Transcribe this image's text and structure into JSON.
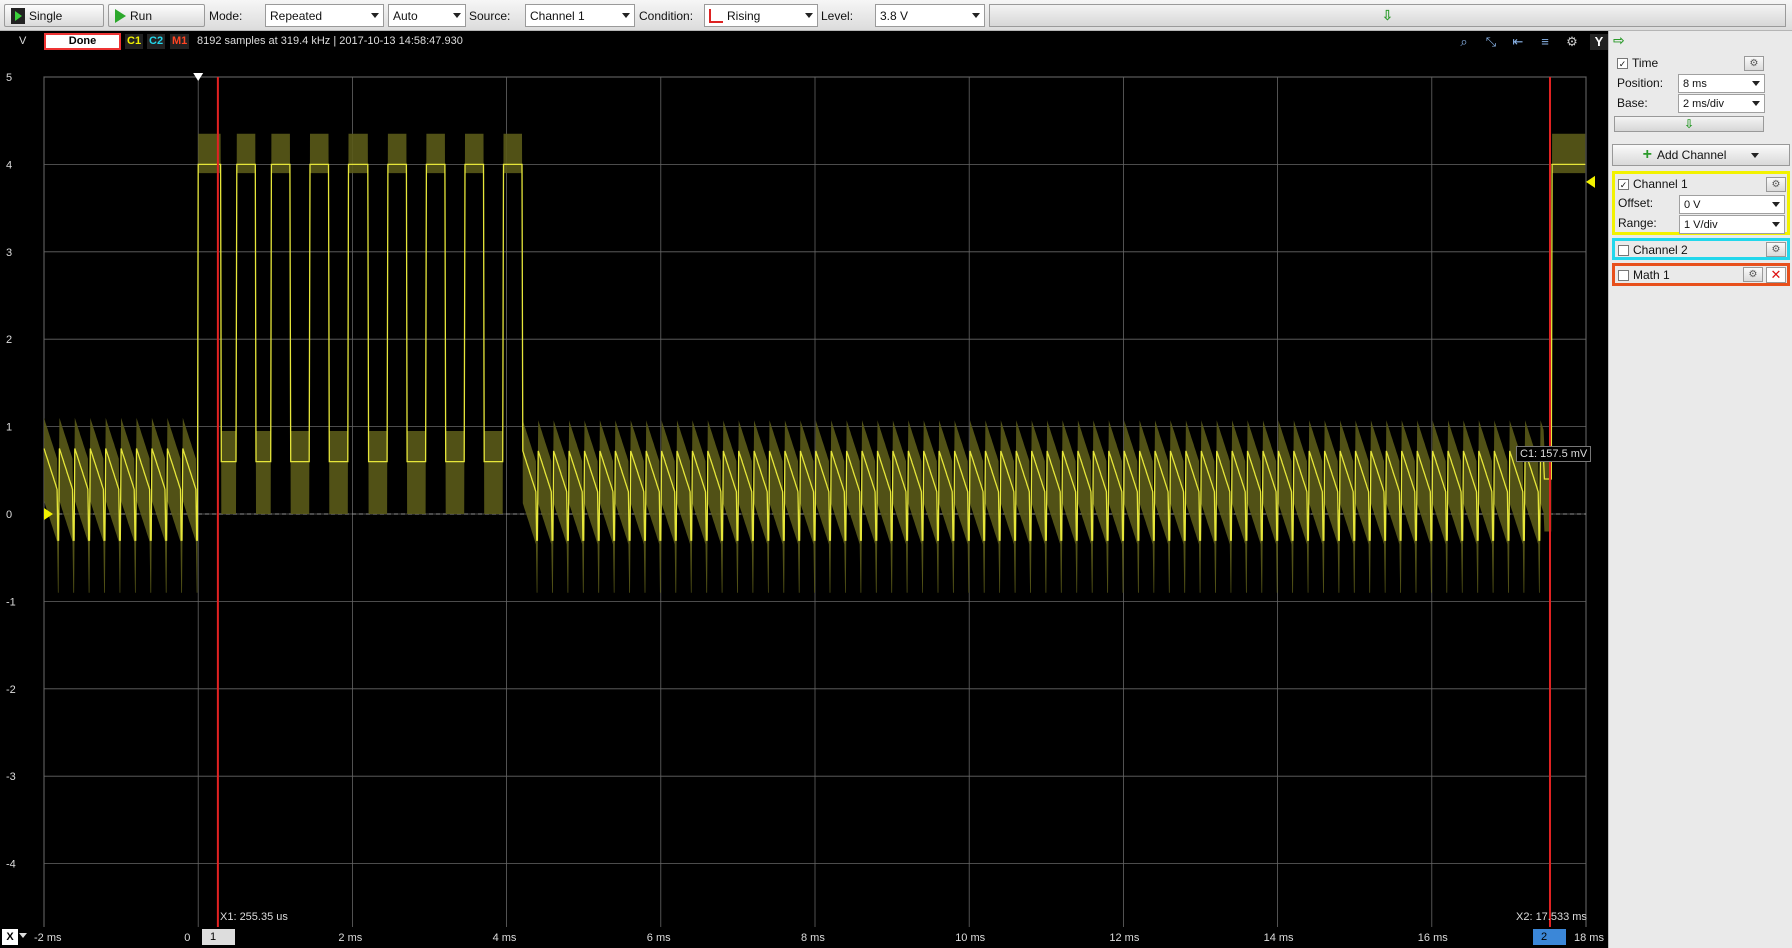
{
  "toolbar": {
    "single_label": "Single",
    "run_label": "Run",
    "mode_label": "Mode:",
    "mode_value": "Repeated",
    "auto_value": "Auto",
    "source_label": "Source:",
    "source_value": "Channel 1",
    "condition_label": "Condition:",
    "condition_value": "Rising",
    "level_label": "Level:",
    "level_value": "3.8 V",
    "slider_glyph": "⇩"
  },
  "scope": {
    "unit_label": "V",
    "status": "Done",
    "tags": [
      "C1",
      "C2",
      "M1"
    ],
    "info": "8192 samples at 319.4 kHz | 2017-10-13 14:58:47.930",
    "y_axis_title": "Y",
    "y_ticks": [
      "5",
      "4",
      "3",
      "2",
      "1",
      "0",
      "-1",
      "-2",
      "-3",
      "-4",
      "-5"
    ],
    "x_ticks": [
      "-2 ms",
      "0",
      "2 ms",
      "4 ms",
      "6 ms",
      "8 ms",
      "10 ms",
      "12 ms",
      "14 ms",
      "16 ms",
      "18 ms"
    ],
    "x_axis_title": "X",
    "cursor1_label": "X1: 255.35 us",
    "cursor2_label": "X2: 17.533 ms",
    "cursor1_index": "1",
    "cursor2_index": "2",
    "measurement": "C1: 157.5 mV",
    "colors": {
      "trace": "#e6e63a",
      "envelope": "#5a5a18",
      "cursor": "#e22222",
      "grid": "#777777"
    }
  },
  "chart_data": {
    "type": "line",
    "xlabel": "",
    "ylabel": "V",
    "xlim": [
      -2,
      18
    ],
    "ylim": [
      -5,
      5
    ],
    "grid": true,
    "series": [
      {
        "name": "C1",
        "x": [
          -2,
          -1.8,
          -1.6,
          -1.4,
          -1.2,
          -1.0,
          -0.2,
          0,
          0.05,
          0.3,
          0.5,
          0.75,
          0.95,
          1.2,
          1.45,
          1.7,
          1.95,
          2.2,
          2.45,
          2.7,
          2.95,
          3.2,
          3.45,
          3.7,
          3.95,
          4.2,
          5,
          8,
          12,
          16,
          17.4,
          17.55,
          18
        ],
        "y": [
          0.6,
          0.3,
          0.7,
          0.3,
          0.7,
          0.3,
          0.5,
          4.0,
          4.0,
          0.6,
          4.0,
          0.6,
          4.0,
          0.6,
          4.0,
          0.6,
          4.0,
          0.6,
          4.0,
          0.6,
          4.0,
          0.6,
          4.0,
          0.6,
          4.0,
          0.6,
          0.7,
          0.6,
          0.7,
          0.6,
          0.4,
          4.0,
          4.0
        ]
      }
    ],
    "cursors": {
      "x1_ms": 0.25535,
      "x2_ms": 17.533
    },
    "trigger_level_v": 3.8
  },
  "panel": {
    "header_glyph": "⇨",
    "time_label": "Time",
    "position_label": "Position:",
    "position_value": "8 ms",
    "base_label": "Base:",
    "base_value": "2 ms/div",
    "time_slider_glyph": "⇩",
    "add_channel_label": "Add Channel",
    "channel1_label": "Channel 1",
    "offset_label": "Offset:",
    "offset_value": "0 V",
    "range_label": "Range:",
    "range_value": "1 V/div",
    "channel2_label": "Channel 2",
    "math1_label": "Math 1",
    "checkmark": "✓",
    "gear_glyph": "⚙",
    "delete_glyph": "✕",
    "colors": {
      "channel1": "#f2f200",
      "channel2": "#22d7ec",
      "math1": "#e8501c"
    }
  }
}
